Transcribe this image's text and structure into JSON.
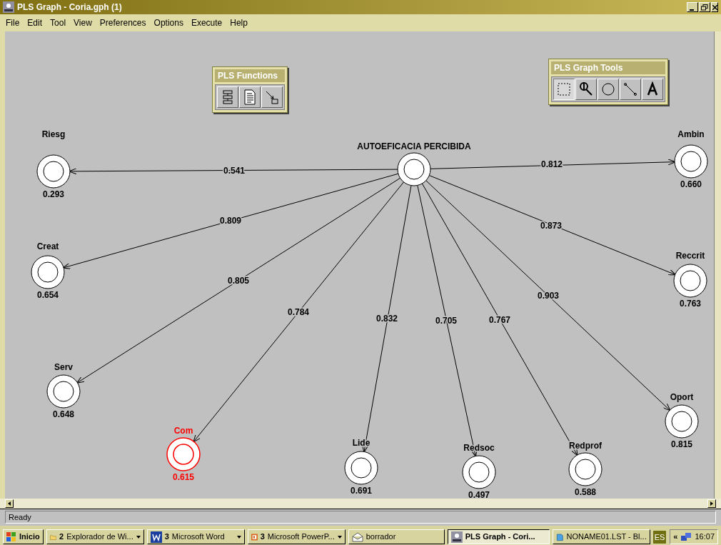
{
  "window": {
    "title": "PLS Graph - Coria.gph (1)"
  },
  "menu": [
    "File",
    "Edit",
    "Tool",
    "View",
    "Preferences",
    "Options",
    "Execute",
    "Help"
  ],
  "palettes": [
    {
      "title": "PLS Functions",
      "tools": [
        {
          "kind": "flowchart",
          "selected": false
        },
        {
          "kind": "report",
          "selected": false
        },
        {
          "kind": "path-value",
          "selected": false
        }
      ]
    },
    {
      "title": "PLS Graph Tools",
      "tools": [
        {
          "kind": "select",
          "selected": true
        },
        {
          "kind": "zoom",
          "selected": false
        },
        {
          "kind": "circle",
          "selected": false
        },
        {
          "kind": "line",
          "selected": false
        },
        {
          "kind": "text",
          "selected": false
        }
      ]
    }
  ],
  "diagram": {
    "center": {
      "name": "AUTOEFICACIA PERCIBIDA"
    },
    "nodes": [
      {
        "name": "Riesg",
        "value": "0.293",
        "coefficient": "0.541",
        "selected": false
      },
      {
        "name": "Ambin",
        "value": "0.660",
        "coefficient": "0.812",
        "selected": false
      },
      {
        "name": "Creat",
        "value": "0.654",
        "coefficient": "0.809",
        "selected": false
      },
      {
        "name": "Reccrit",
        "value": "0.763",
        "coefficient": "0.873",
        "selected": false
      },
      {
        "name": "Serv",
        "value": "0.648",
        "coefficient": "0.805",
        "selected": false
      },
      {
        "name": "Oport",
        "value": "0.815",
        "coefficient": "0.903",
        "selected": false
      },
      {
        "name": "Com",
        "value": "0.615",
        "coefficient": "0.784",
        "selected": true
      },
      {
        "name": "Lide",
        "value": "0.691",
        "coefficient": "0.832",
        "selected": false
      },
      {
        "name": "Redsoc",
        "value": "0.497",
        "coefficient": "0.705",
        "selected": false
      },
      {
        "name": "Redprof",
        "value": "0.588",
        "coefficient": "0.767",
        "selected": false
      }
    ]
  },
  "status_bar": "Ready",
  "taskbar": {
    "start": "Inicio",
    "items": [
      {
        "count": "2",
        "label": "Explorador de Wi...",
        "dropdown": true,
        "selected": false
      },
      {
        "count": "3",
        "label": "Microsoft Word",
        "dropdown": true,
        "selected": false
      },
      {
        "count": "3",
        "label": "Microsoft PowerP...",
        "dropdown": true,
        "selected": false
      },
      {
        "label": "borrador",
        "dropdown": false,
        "selected": false
      },
      {
        "label": "PLS Graph - Cori...",
        "dropdown": false,
        "selected": true
      },
      {
        "label": "NONAME01.LST - Bl...",
        "dropdown": false,
        "selected": false
      }
    ],
    "language": "ES",
    "tray_toggle": "«",
    "clock": "16:07"
  }
}
